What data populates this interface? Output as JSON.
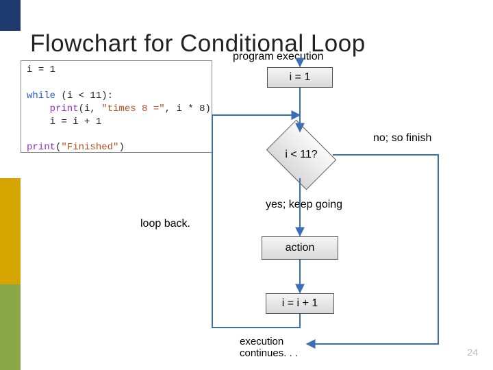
{
  "title": "Flowchart for Conditional Loop",
  "code": {
    "line1_lhs": "i ",
    "line1_op": "= ",
    "line1_rhs": "1",
    "blank1": "",
    "line2_kw": "while ",
    "line2_rest": "(i < 11):",
    "line3_fn": "    print",
    "line3_rest": "(i, ",
    "line3_str": "\"times 8 =\"",
    "line3_end": ", i * 8)",
    "line4": "    i = i + 1",
    "blank2": "",
    "line5_fn": "print",
    "line5_str": "\"Finished\"",
    "line5_paren_open": "(",
    "line5_paren_close": ")"
  },
  "flow": {
    "program_execution": "program execution",
    "init": "i = 1",
    "decision": "i < 11?",
    "no_label": "no; so finish",
    "yes_label": "yes; keep going",
    "loop_back": "loop back.",
    "action": "action",
    "increment": "i = i + 1",
    "continues": "execution\ncontinues. . ."
  },
  "slide_number": "24"
}
